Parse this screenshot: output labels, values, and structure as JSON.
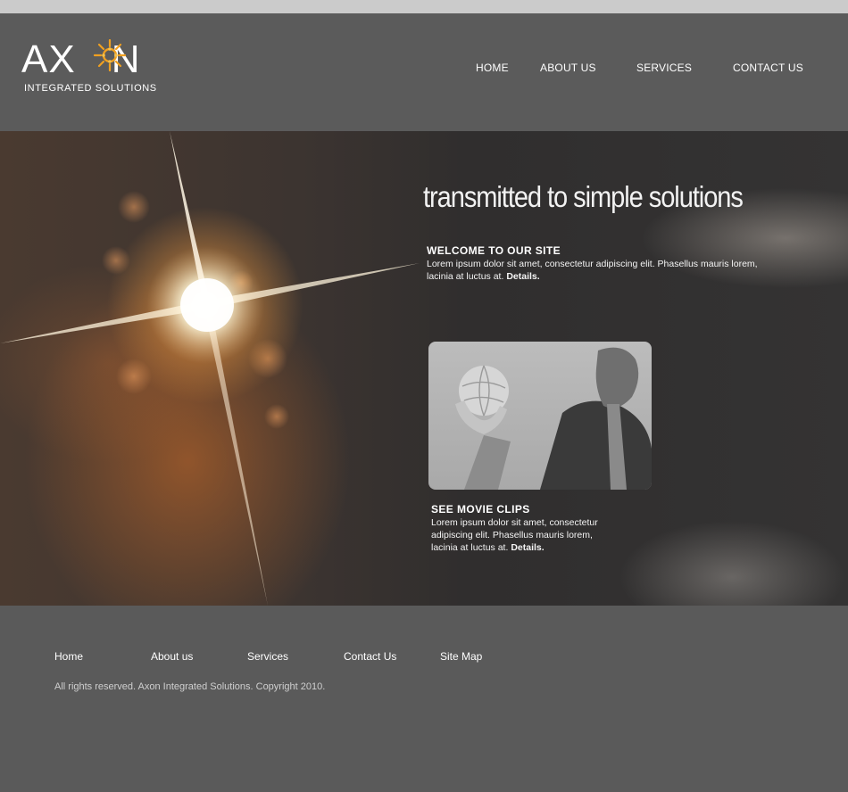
{
  "brand": {
    "name_left": "AX",
    "name_right": "N",
    "tagline": "INTEGRATED SOLUTIONS",
    "accent_color": "#f0a020"
  },
  "nav": [
    {
      "label": "HOME"
    },
    {
      "label": "ABOUT US"
    },
    {
      "label": "SERVICES"
    },
    {
      "label": "CONTACT US"
    }
  ],
  "hero": {
    "headline": "transmitted to simple solutions",
    "welcome": {
      "title": "WELCOME TO OUR SITE",
      "text": "Lorem ipsum dolor sit amet, consectetur adipiscing elit. Phasellus mauris lorem, lacinia at luctus at.",
      "link": "Details."
    },
    "movies": {
      "title": "SEE MOVIE CLIPS",
      "text": "Lorem ipsum dolor sit amet, consectetur adipiscing elit. Phasellus mauris lorem, lacinia at luctus at.",
      "link": "Details."
    }
  },
  "footer": {
    "links": [
      {
        "label": "Home"
      },
      {
        "label": "About us"
      },
      {
        "label": "Services"
      },
      {
        "label": "Contact Us"
      },
      {
        "label": "Site Map"
      }
    ],
    "copyright": "All rights reserved. Axon Integrated Solutions. Copyright 2010."
  },
  "colors": {
    "header_bg": "#5b5b5b",
    "top_strip": "#cbcbcb",
    "footer_bg": "#5a5a5a",
    "text": "#ffffff"
  }
}
